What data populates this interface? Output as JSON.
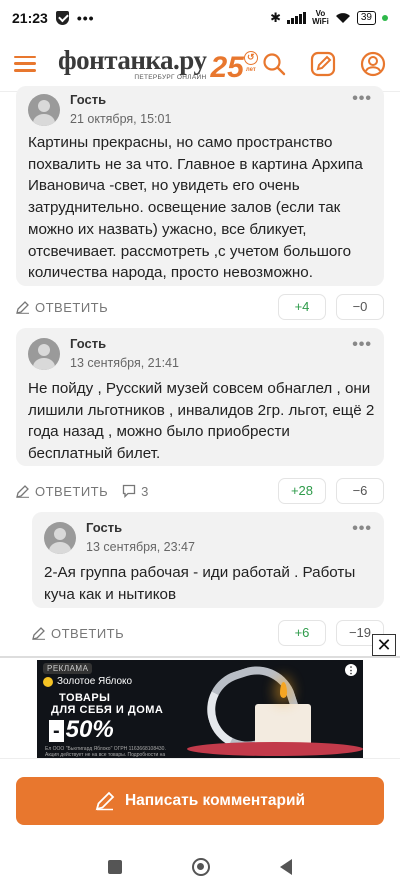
{
  "status_bar": {
    "time": "21:23",
    "dots": "•••",
    "bluetooth": "✱",
    "network_label_top": "Vo",
    "network_label_bottom": "WiFi",
    "battery": "39"
  },
  "header": {
    "logo_text": "фонтанка.ру",
    "logo_subtitle": "ПЕТЕРБУРГ ОНЛАЙН",
    "anniversary": "25",
    "anniversary_suffix": "лет"
  },
  "comments": [
    {
      "author": "Гость",
      "date": "21 октября, 15:01",
      "text": "Картины прекрасны, но само пространство похвалить не за что. Главное в картина Архипа Ивановича -свет, но увидеть его очень затруднительно. освещение залов (если так можно их назвать) ужасно, все бликует, отсвечивает. рассмотреть ,с учетом большого количества народа, просто невозможно.",
      "reply_label": "ОТВЕТИТЬ",
      "replies": "",
      "upvotes": "+4",
      "downvotes": "−0"
    },
    {
      "author": "Гость",
      "date": "13 сентября, 21:41",
      "text": "Не пойду , Русский музей совсем обнаглел , они лишили льготников , инвалидов 2гр. льгот, ещё 2 года назад , можно было приобрести бесплатный билет.",
      "reply_label": "ОТВЕТИТЬ",
      "replies": "3",
      "upvotes": "+28",
      "downvotes": "−6"
    },
    {
      "author": "Гость",
      "date": "13 сентября, 23:47",
      "text": "2-Ая группа рабочая - иди работай . Работы куча как и нытиков",
      "reply_label": "ОТВЕТИТЬ",
      "replies": "",
      "upvotes": "+6",
      "downvotes": "−19"
    }
  ],
  "ad": {
    "close": "✕",
    "badge": "РЕКЛАМА",
    "brand": "Золотое Яблоко",
    "line1": "ТОВАРЫ",
    "line2": "ДЛЯ СЕБЯ И ДОМА",
    "discount_prefix": "-",
    "discount": "50%",
    "legal": "Ел ООО \"Бьютигард Яблоко\" ОГРН 1163668108430. Акция действует не на все товары. Подробности на сайте и в приложении.",
    "info": "⋮"
  },
  "write_button": {
    "label": "Написать комментарий"
  },
  "colors": {
    "accent": "#e8772e",
    "card_bg": "#f2f2f2",
    "upvote": "#2e9b4a"
  }
}
